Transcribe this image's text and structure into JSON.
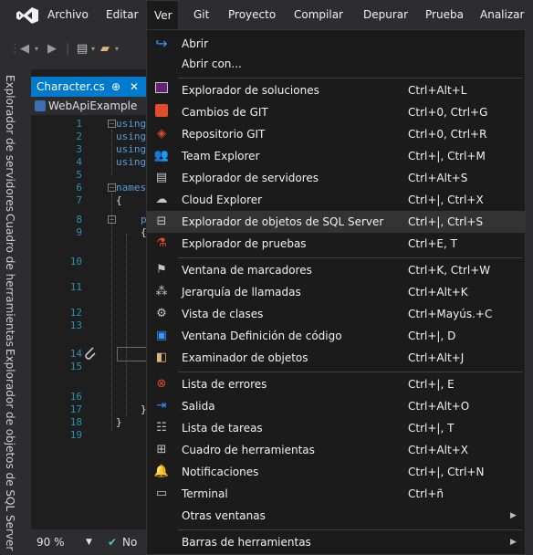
{
  "menubar": {
    "items": [
      "Archivo",
      "Editar",
      "Ver",
      "Git",
      "Proyecto",
      "Compilar",
      "Depurar",
      "Prueba",
      "Analizar"
    ],
    "open_item": "Ver"
  },
  "side_tabs": [
    "Explorador de servidores",
    "Cuadro de herramientas",
    "Explorador de objetos de SQL Server"
  ],
  "editor": {
    "tab_label": "Character.cs",
    "tab_pin": "⊕",
    "tab_close": "✕",
    "nav_label": "WebApiExample",
    "line_numbers": [
      "1",
      "2",
      "3",
      "4",
      "5",
      "6",
      "7",
      "8",
      "9",
      "10",
      "11",
      "12",
      "13",
      "14",
      "15",
      "16",
      "17",
      "18",
      "19"
    ],
    "code": {
      "l1": "using",
      "l2": "using",
      "l3": "using",
      "l4": "using",
      "l6": "names",
      "l7": "{",
      "l8": "p",
      "l9": "{",
      "l17": "}",
      "l18": "}"
    },
    "zoom": "90 %",
    "status_text": "No"
  },
  "menu": {
    "items": [
      {
        "label": "Abrir",
        "shortcut": "",
        "icon": "redo-arrow-icon"
      },
      {
        "label": "Abrir con...",
        "shortcut": "",
        "icon": ""
      },
      {
        "label": "Explorador de soluciones",
        "shortcut": "Ctrl+Alt+L",
        "icon": "solution-explorer-icon"
      },
      {
        "label": "Cambios de GIT",
        "shortcut": "Ctrl+0, Ctrl+G",
        "icon": "git-changes-icon"
      },
      {
        "label": "Repositorio GIT",
        "shortcut": "Ctrl+0, Ctrl+R",
        "icon": "git-repository-icon"
      },
      {
        "label": "Team Explorer",
        "shortcut": "Ctrl+|, Ctrl+M",
        "icon": "team-explorer-icon"
      },
      {
        "label": "Explorador de servidores",
        "shortcut": "Ctrl+Alt+S",
        "icon": "server-explorer-icon"
      },
      {
        "label": "Cloud Explorer",
        "shortcut": "Ctrl+|, Ctrl+X",
        "icon": "cloud-icon"
      },
      {
        "label": "Explorador de objetos de SQL Server",
        "shortcut": "Ctrl+|, Ctrl+S",
        "icon": "sql-server-icon"
      },
      {
        "label": "Explorador de pruebas",
        "shortcut": "Ctrl+E, T",
        "icon": "test-explorer-icon"
      },
      {
        "label": "Ventana de marcadores",
        "shortcut": "Ctrl+K, Ctrl+W",
        "icon": "bookmark-icon"
      },
      {
        "label": "Jerarquía de llamadas",
        "shortcut": "Ctrl+Alt+K",
        "icon": "call-hierarchy-icon"
      },
      {
        "label": "Vista de clases",
        "shortcut": "Ctrl+Mayús.+C",
        "icon": "class-view-icon"
      },
      {
        "label": "Ventana Definición de código",
        "shortcut": "Ctrl+|, D",
        "icon": "code-definition-icon"
      },
      {
        "label": "Examinador de objetos",
        "shortcut": "Ctrl+Alt+J",
        "icon": "object-browser-icon"
      },
      {
        "label": "Lista de errores",
        "shortcut": "Ctrl+|, E",
        "icon": "error-list-icon"
      },
      {
        "label": "Salida",
        "shortcut": "Ctrl+Alt+O",
        "icon": "output-icon"
      },
      {
        "label": "Lista de tareas",
        "shortcut": "Ctrl+|, T",
        "icon": "task-list-icon"
      },
      {
        "label": "Cuadro de herramientas",
        "shortcut": "Ctrl+Alt+X",
        "icon": "toolbox-icon"
      },
      {
        "label": "Notificaciones",
        "shortcut": "Ctrl+|, Ctrl+N",
        "icon": "bell-icon"
      },
      {
        "label": "Terminal",
        "shortcut": "Ctrl+ñ",
        "icon": "terminal-icon"
      },
      {
        "label": "Otras ventanas",
        "shortcut": "",
        "icon": "",
        "submenu": true
      },
      {
        "label": "Barras de herramientas",
        "shortcut": "",
        "icon": "",
        "submenu": true
      }
    ],
    "highlighted": "Explorador de objetos de SQL Server"
  },
  "colors": {
    "accent": "#007acc",
    "menu_bg": "#1b1b1c",
    "chrome_bg": "#2d2d30",
    "editor_bg": "#1e1e1e"
  }
}
